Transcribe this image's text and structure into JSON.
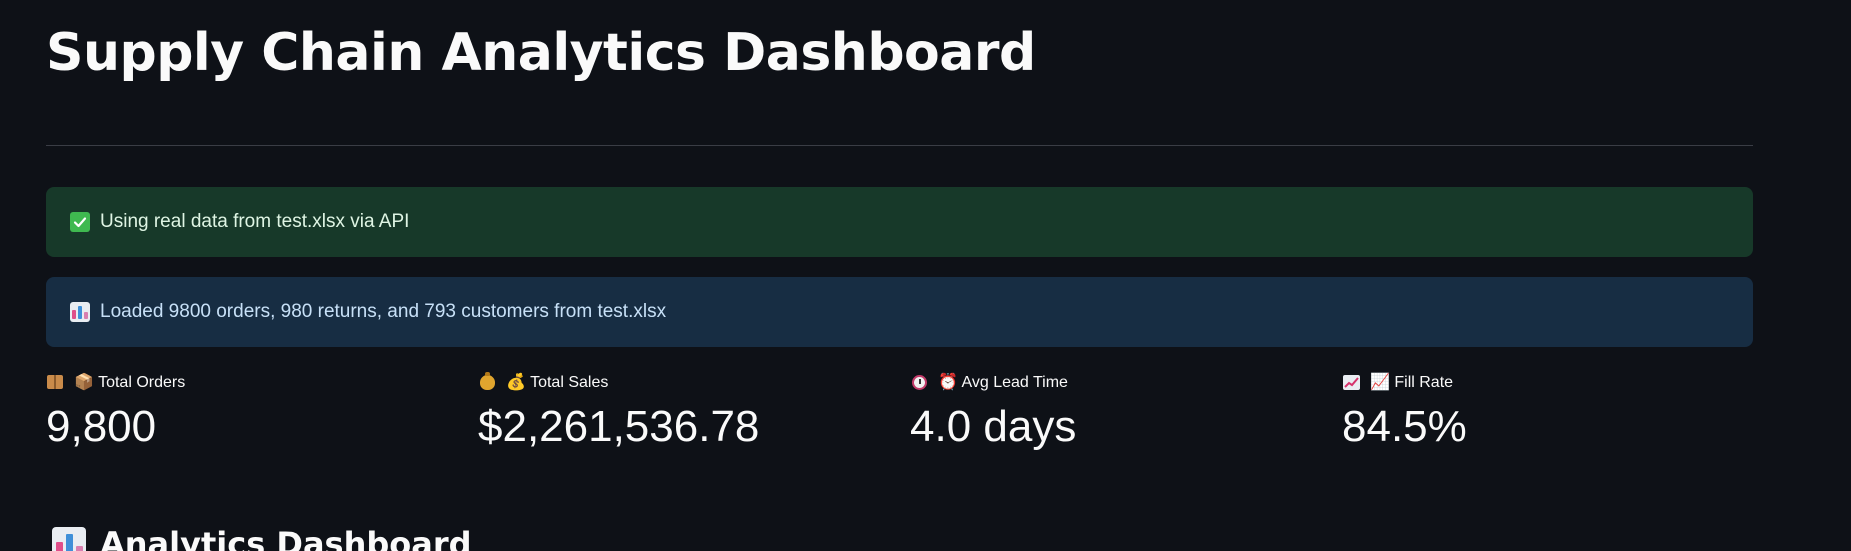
{
  "page": {
    "title": "Supply Chain Analytics Dashboard"
  },
  "alerts": {
    "success": "Using real data from test.xlsx via API",
    "info": "Loaded 9800 orders, 980 returns, and 793 customers from test.xlsx"
  },
  "metrics": [
    {
      "icon": "package-icon",
      "label": "📦 Total Orders",
      "value": "9,800"
    },
    {
      "icon": "money-bag-icon",
      "label": "💰 Total Sales",
      "value": "$2,261,536.78"
    },
    {
      "icon": "alarm-clock-icon",
      "label": "⏰ Avg Lead Time",
      "value": "4.0 days"
    },
    {
      "icon": "chart-increasing-icon",
      "label": "📈 Fill Rate",
      "value": "84.5%"
    }
  ],
  "section": {
    "heading": "Analytics Dashboard"
  },
  "colors": {
    "background": "#0e1117",
    "success_bg": "#173929",
    "info_bg": "#172d43",
    "text": "#fafafa"
  }
}
